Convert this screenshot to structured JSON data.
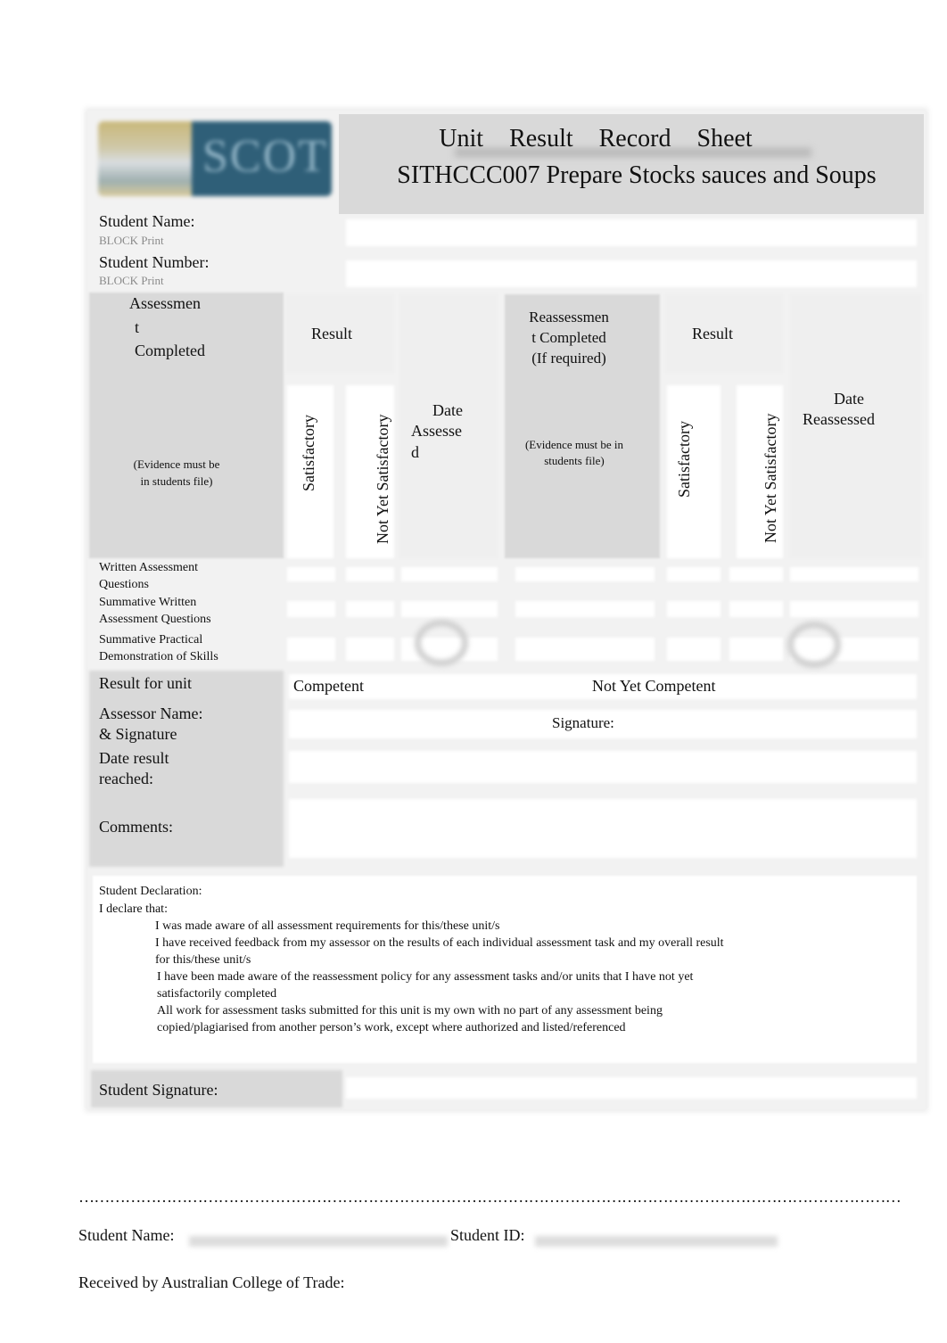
{
  "header": {
    "logo_text": "SCOT",
    "title_words": "Unit Result Record Sheet",
    "subtitle": "SITHCCC007 Prepare Stocks sauces and Soups"
  },
  "student": {
    "name_label": "Student Name:",
    "name_hint": "BLOCK Print",
    "name_value": "",
    "number_label": "Student Number:",
    "number_hint": "BLOCK Print",
    "number_value": ""
  },
  "table": {
    "assessment_header": {
      "line1": "Assessmen",
      "line2": "t",
      "line3": "Completed",
      "note_line1": "(Evidence must be",
      "note_line2": "in students file)"
    },
    "result_header": "Result",
    "satisfactory": "Satisfactory",
    "not_yet_satisfactory": "Not Yet Satisfactory",
    "date_assessed": {
      "line1": "Date",
      "line2": "Assesse",
      "line3": "d"
    },
    "reassessment_header": {
      "line1": "Reassessmen",
      "line2": "t Completed",
      "line3": "(If required)",
      "note_line1": "(Evidence must be in",
      "note_line2": "students file)"
    },
    "result_header_2": "Result",
    "satisfactory_2": "Satisfactory",
    "not_yet_satisfactory_2": "Not Yet Satisfactory",
    "date_reassessed": {
      "line1": "Date",
      "line2": "Reassessed"
    },
    "rows": [
      {
        "line1": "Written Assessment",
        "line2": "Questions"
      },
      {
        "line1": "Summative Written",
        "line2": "Assessment Questions"
      },
      {
        "line1": "Summative Practical",
        "line2": "Demonstration of Skills"
      }
    ]
  },
  "result_unit": {
    "label": "Result for unit",
    "competent": "Competent",
    "not_yet_competent": "Not Yet Competent"
  },
  "assessor": {
    "label_line1": "Assessor Name:",
    "label_line2": "& Signature",
    "signature_label": "Signature:"
  },
  "date_result": {
    "label_line1": "Date result",
    "label_line2": "reached:"
  },
  "comments": {
    "label": "Comments:"
  },
  "declaration": {
    "title": "Student Declaration:",
    "intro": "I declare that:",
    "bullet_glyph": "",
    "items": [
      {
        "line1": "I was made aware of all assessment requirements for this/these unit/s",
        "line2": ""
      },
      {
        "line1": "I have received feedback from my assessor on the results of each individual assessment task and my overall result",
        "line2": "for this/these unit/s"
      },
      {
        "line1": "I have been made aware of the reassessment policy for any assessment tasks and/or units that I have not yet",
        "line2": "satisfactorily completed"
      },
      {
        "line1": "All work for assessment tasks submitted for this unit is my own with no part of any assessment being",
        "line2": "copied/plagiarised from another person’s work, except where authorized and listed/referenced"
      }
    ]
  },
  "student_signature": {
    "label": "Student Signature:"
  },
  "receipt": {
    "dotted_line": "……………………………………………………………………………………………………………………………………………",
    "name_label": "Student Name:",
    "id_label": "Student ID:",
    "received_label": "Received by Australian College of Trade:"
  }
}
